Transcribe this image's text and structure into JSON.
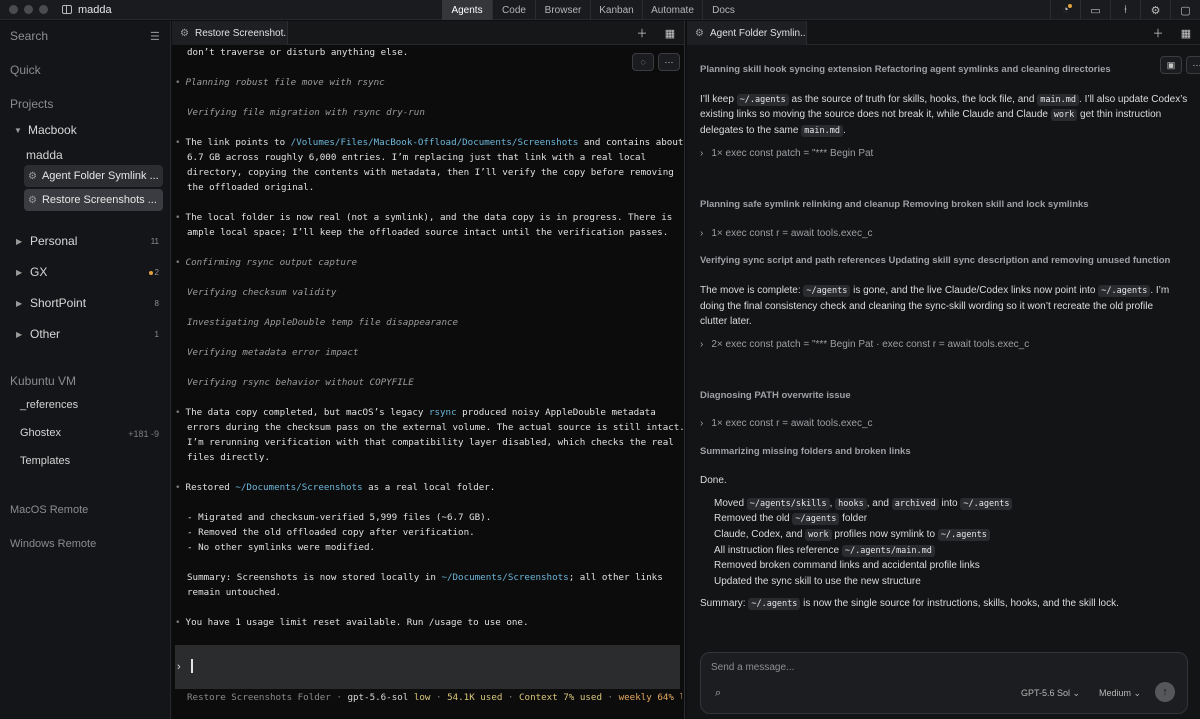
{
  "app": {
    "title": "madda"
  },
  "nav": [
    "Agents",
    "Code",
    "Browser",
    "Kanban",
    "Automate",
    "Docs"
  ],
  "sidebar": {
    "search": "Search",
    "quick": "Quick",
    "projects": "Projects",
    "macbook": "Macbook",
    "madda": "madda",
    "active1": "Agent Folder Symlink ...",
    "active2": "Restore Screenshots ...",
    "groups": [
      {
        "label": "Personal",
        "count": "11"
      },
      {
        "label": "GX",
        "count": "2"
      },
      {
        "label": "ShortPoint",
        "count": "8"
      },
      {
        "label": "Other",
        "count": "1"
      }
    ],
    "kubuntu": "Kubuntu VM",
    "refs": "_references",
    "ghostex": "Ghostex",
    "ghostex_diff": "+181 -9",
    "templates": "Templates",
    "macos_remote": "MacOS Remote",
    "windows_remote": "Windows Remote"
  },
  "pane1": {
    "tab": "Restore Screenshot...",
    "lines": {
      "l0": "don’t traverse or disturb anything else.",
      "l1": "Planning robust file move with rsync",
      "l2": "Verifying file migration with rsync dry-run",
      "l3a": "The link points to ",
      "l3p": "/Volumes/Files/MacBook-Offload/Documents/Screenshots",
      "l3b": " and contains about",
      "l4": "6.7 GB across roughly 6,000 entries. I’m replacing just that link with a real local",
      "l5": "directory, copying the contents with metadata, then I’ll verify the copy before removing",
      "l6": "the offloaded original.",
      "l7": "The local folder is now real (not a symlink), and the data copy is in progress. There is",
      "l8": "ample local space; I’ll keep the offloaded source intact until the verification passes.",
      "l9": "Confirming rsync output capture",
      "l10": "Verifying checksum validity",
      "l11": "Investigating AppleDouble temp file disappearance",
      "l12": "Verifying metadata error impact",
      "l13": "Verifying rsync behavior without COPYFILE",
      "l14a": "The data copy completed, but macOS’s legacy ",
      "l14p": "rsync",
      "l14b": " produced noisy AppleDouble metadata",
      "l15": "errors during the checksum pass on the external volume. The actual source is still intact.",
      "l16": "I’m rerunning verification with that compatibility layer disabled, which checks the real",
      "l17": "files directly.",
      "l18a": "Restored ",
      "l18p": "~/Documents/Screenshots",
      "l18b": " as a real local folder.",
      "l19": "- Migrated and checksum-verified 5,999 files (~6.7 GB).",
      "l20": "- Removed the old offloaded copy after verification.",
      "l21": "- No other symlinks were modified.",
      "l22a": "Summary: Screenshots is now stored locally in ",
      "l22p": "~/Documents/Screenshots",
      "l22b": "; all other links",
      "l23": "remain untouched.",
      "l24": "You have 1 usage limit reset available. Run /usage to use one."
    },
    "prompt_caret": "›",
    "status": {
      "name": "Restore Screenshots Folder",
      "model": "gpt-5.6-sol",
      "effort": "low",
      "used": "54.1K used",
      "context": "Context 7% used",
      "weekly": "weekly 64% l…"
    }
  },
  "pane2": {
    "tab": "Agent Folder Symlin...",
    "h1": "Planning skill hook syncing extension Refactoring agent symlinks and cleaning directories",
    "p1a": "I’ll keep ",
    "p1c1": "~/.agents",
    "p1b": " as the source of truth for skills, hooks, the lock file, and ",
    "p1c2": "main.md",
    "p1d": ". I’ll also update Codex’s",
    "p1e": "existing links so moving the source does not break it, while Claude and Claude ",
    "p1c3": "work",
    "p1f": " get thin instruction",
    "p1g": "delegates to the same ",
    "p1c4": "main.md",
    "p1h": ".",
    "t1": "1× exec const patch = \"*** Begin Pat",
    "h2": "Planning safe symlink relinking and cleanup Removing broken skill and lock symlinks",
    "t2": "1× exec const r = await tools.exec_c",
    "h3": "Verifying sync script and path references Updating skill sync description and removing unused function",
    "p2a": "The move is complete: ",
    "p2c1": "~/agents",
    "p2b": " is gone, and the live Claude/Codex links now point into ",
    "p2c2": "~/.agents",
    "p2d": ". I’m",
    "p2e": "doing the final consistency check and cleaning the sync-skill wording so it won’t recreate the old profile",
    "p2f": "clutter later.",
    "t3": "2× exec const patch = \"*** Begin Pat · exec const r = await tools.exec_c",
    "h4": "Diagnosing PATH overwrite issue",
    "t4": "1× exec const r = await tools.exec_c",
    "h5": "Summarizing missing folders and broken links",
    "done": "Done.",
    "li1a": "Moved ",
    "li1c1": "~/agents/skills",
    "li1b": ", ",
    "li1c2": "hooks",
    "li1d": ", and ",
    "li1c3": "archived",
    "li1e": " into ",
    "li1c4": "~/.agents",
    "li2a": "Removed the old ",
    "li2c": "~/agents",
    "li2b": " folder",
    "li3a": "Claude, Codex, and ",
    "li3c1": "work",
    "li3b": " profiles now symlink to ",
    "li3c2": "~/.agents",
    "li4a": "All instruction files reference ",
    "li4c": "~/.agents/main.md",
    "li5": "Removed broken command links and accidental profile links",
    "li6": "Updated the sync skill to use the new structure",
    "suma": "Summary: ",
    "sumc": "~/.agents",
    "sumb": " is now the single source for instructions, skills, hooks, and the skill lock.",
    "composer": {
      "placeholder": "Send a message...",
      "model": "GPT-5.6 Sol",
      "effort": "Medium"
    }
  }
}
